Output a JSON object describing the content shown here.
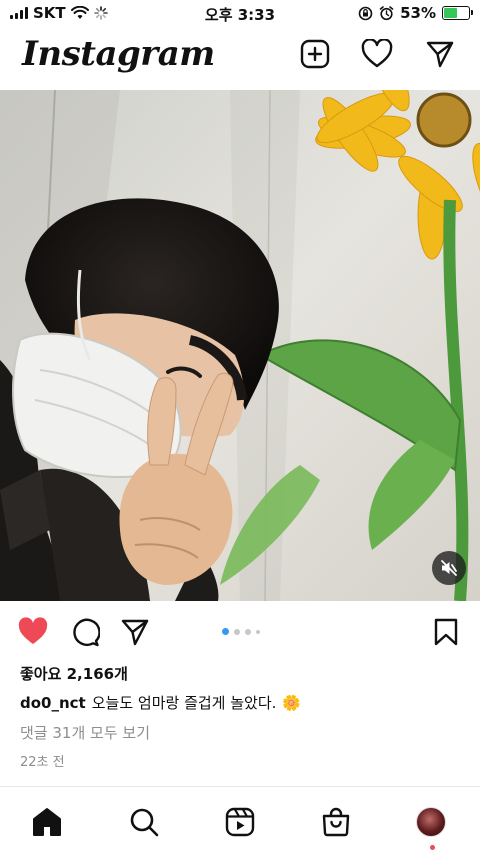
{
  "status_bar": {
    "carrier": "SKT",
    "time": "오후 3:33",
    "battery_percent": "53%",
    "battery_level": 0.53,
    "icons": [
      "signal-icon",
      "wifi-icon",
      "loading-icon",
      "screen-rotation-lock-icon",
      "alarm-icon",
      "battery-charging-icon"
    ]
  },
  "header": {
    "logo": "Instagram",
    "icons": [
      "new-post-icon",
      "heart-icon",
      "direct-message-icon"
    ]
  },
  "post": {
    "media_description_icon": "muted-speaker-icon",
    "carousel": {
      "count": 4,
      "active_index": 0
    },
    "actions": [
      "like-icon",
      "comment-icon",
      "share-icon",
      "save-icon"
    ],
    "liked": true,
    "likes_text": "좋아요 2,166개",
    "username": "do0_nct",
    "caption": "오늘도 엄마랑 즐겁게 놀았다.",
    "caption_emoji": "🌼",
    "comments_link": "댓글 31개 모두 보기",
    "timestamp": "22초 전"
  },
  "bottom_nav": {
    "items": [
      "home-icon",
      "search-icon",
      "reels-icon",
      "shop-icon",
      "profile-avatar"
    ]
  },
  "colors": {
    "like_red": "#ed4956",
    "carousel_active": "#3897f0",
    "carousel_inactive": "#c7c7c7",
    "muted_text": "#8e8e8e",
    "battery_green": "#34c759",
    "notification_dot": "#ed4956"
  }
}
